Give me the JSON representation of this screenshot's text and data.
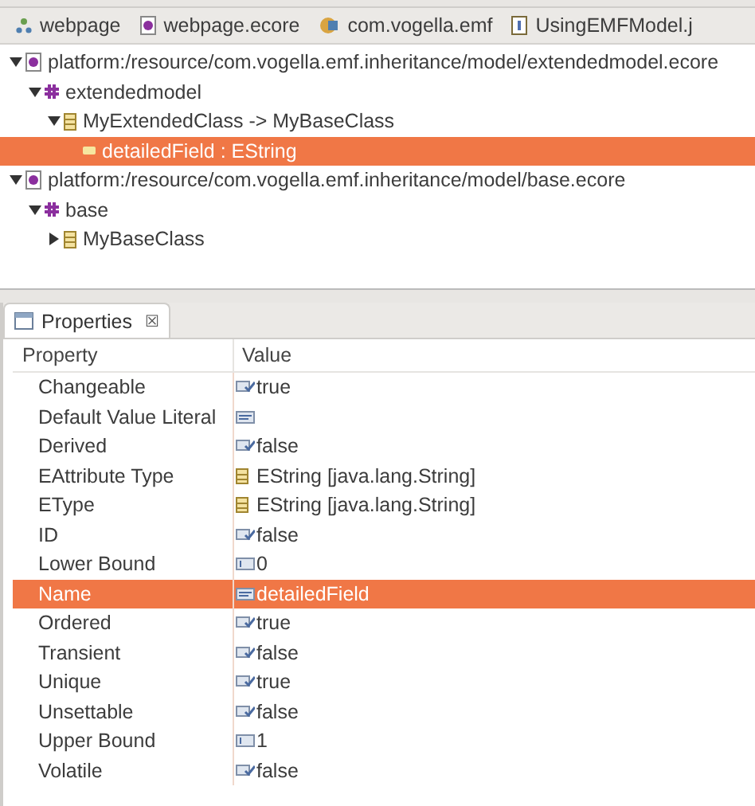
{
  "editor_tabs": [
    {
      "label": "webpage",
      "kind": "model"
    },
    {
      "label": "webpage.ecore",
      "kind": "ecore"
    },
    {
      "label": "com.vogella.emf",
      "kind": "plugin"
    },
    {
      "label": "UsingEMFModel.j",
      "kind": "java"
    }
  ],
  "tree": [
    {
      "label": "platform:/resource/com.vogella.emf.inheritance/model/extendedmodel.ecore",
      "kind": "resource",
      "expanded": true,
      "selected": false,
      "children": [
        {
          "label": "extendedmodel",
          "kind": "package",
          "expanded": true,
          "selected": false,
          "children": [
            {
              "label": "MyExtendedClass -> MyBaseClass",
              "kind": "class",
              "expanded": true,
              "selected": false,
              "children": [
                {
                  "label": "detailedField : EString",
                  "kind": "attribute",
                  "selected": true
                }
              ]
            }
          ]
        }
      ]
    },
    {
      "label": "platform:/resource/com.vogella.emf.inheritance/model/base.ecore",
      "kind": "resource",
      "expanded": true,
      "selected": false,
      "children": [
        {
          "label": "base",
          "kind": "package",
          "expanded": true,
          "selected": false,
          "children": [
            {
              "label": "MyBaseClass",
              "kind": "class",
              "expanded": false,
              "selected": false
            }
          ]
        }
      ]
    }
  ],
  "properties": {
    "title": "Properties",
    "close": "☒",
    "columns": [
      "Property",
      "Value"
    ],
    "rows": [
      {
        "property": "Changeable",
        "value": "true",
        "kind": "bool",
        "selected": false
      },
      {
        "property": "Default Value Literal",
        "kind": "text",
        "selected": false
      },
      {
        "property": "Derived",
        "value": "false",
        "kind": "bool",
        "selected": false
      },
      {
        "property": "EAttribute Type",
        "value": "EString [java.lang.String]",
        "kind": "type",
        "selected": false
      },
      {
        "property": "EType",
        "value": "EString [java.lang.String]",
        "kind": "type",
        "selected": false
      },
      {
        "property": "ID",
        "value": "false",
        "kind": "bool",
        "selected": false
      },
      {
        "property": "Lower Bound",
        "value": "0",
        "kind": "int",
        "selected": false
      },
      {
        "property": "Name",
        "value": "detailedField",
        "kind": "text",
        "selected": true
      },
      {
        "property": "Ordered",
        "value": "true",
        "kind": "bool",
        "selected": false
      },
      {
        "property": "Transient",
        "value": "false",
        "kind": "bool",
        "selected": false
      },
      {
        "property": "Unique",
        "value": "true",
        "kind": "bool",
        "selected": false
      },
      {
        "property": "Unsettable",
        "value": "false",
        "kind": "bool",
        "selected": false
      },
      {
        "property": "Upper Bound",
        "value": "1",
        "kind": "int",
        "selected": false
      },
      {
        "property": "Volatile",
        "value": "false",
        "kind": "bool",
        "selected": false
      }
    ]
  }
}
